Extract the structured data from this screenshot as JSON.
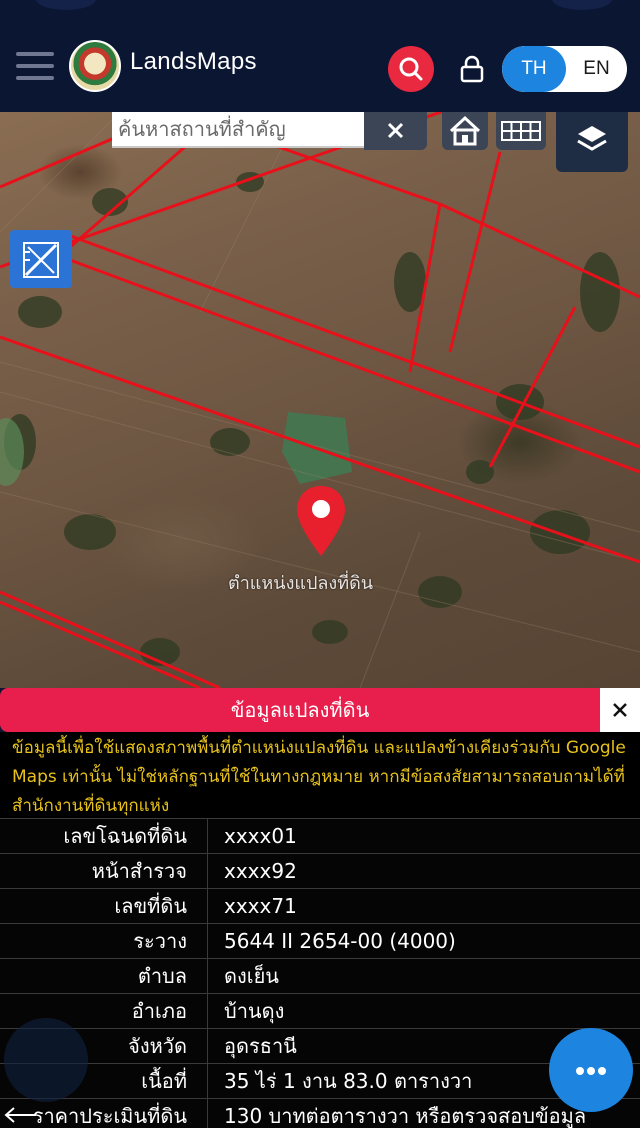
{
  "header": {
    "brand": "LandsMaps",
    "lang_th": "TH",
    "lang_en": "EN",
    "active_lang": "TH",
    "accent": "#e8293f",
    "lang_active_color": "#1d85e0"
  },
  "map": {
    "search_placeholder": "ค้นหาสถานที่สำคัญ",
    "clear_symbol": "✕",
    "pin_label": "ตำแหน่งแปลงที่ดิน",
    "parcel_line_color": "#e8101a"
  },
  "panel": {
    "title": "ข้อมูลแปลงที่ดิน",
    "close_symbol": "✕",
    "disclaimer": "ข้อมูลนี้เพื่อใช้แสดงสภาพพื้นที่ตำแหน่งแปลงที่ดิน และแปลงข้างเคียงร่วมกับ Google Maps เท่านั้น ไม่ใช่หลักฐานที่ใช้ในทางกฎหมาย หากมีข้อสงสัยสามารถสอบถามได้ที่สำนักงานที่ดินทุกแห่ง",
    "rows": [
      {
        "label": "เลขโฉนดที่ดิน",
        "value": "xxxx01"
      },
      {
        "label": "หน้าสำรวจ",
        "value": "xxxx92"
      },
      {
        "label": "เลขที่ดิน",
        "value": "xxxx71"
      },
      {
        "label": "ระวาง",
        "value": "5644 II 2654-00 (4000)"
      },
      {
        "label": "ตำบล",
        "value": "ดงเย็น"
      },
      {
        "label": "อำเภอ",
        "value": "บ้านดุง"
      },
      {
        "label": "จังหวัด",
        "value": "อุดรธานี"
      },
      {
        "label": "เนื้อที่",
        "value": "35 ไร่ 1 งาน 83.0 ตารางวา"
      },
      {
        "label": "ราคาประเมินที่ดิน",
        "value": "130 บาทต่อตารางวา หรือตรวจสอบข้อมูล"
      }
    ]
  },
  "icons": {
    "menu": "hamburger-icon",
    "search": "search-icon",
    "lock": "lock-icon",
    "home": "home-icon",
    "grid": "grid-icon",
    "layers": "layers-icon",
    "measure": "ruler-pencil-icon",
    "pin": "map-pin-icon",
    "more": "more-dots-icon"
  }
}
